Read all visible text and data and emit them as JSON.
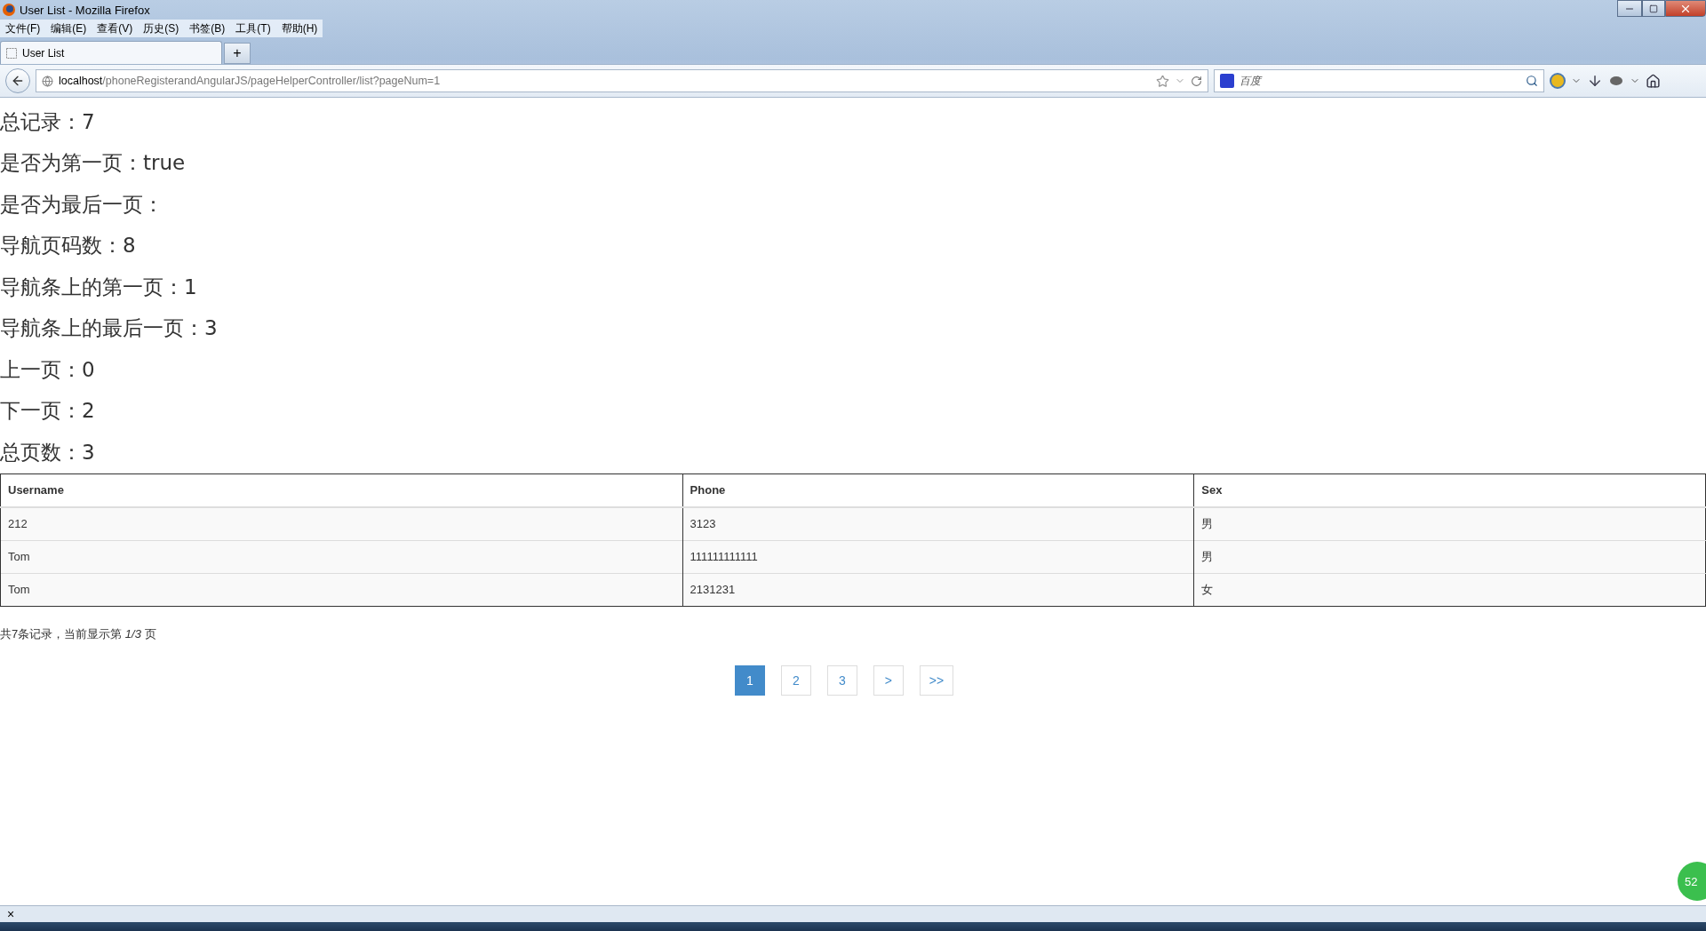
{
  "window": {
    "title": "User List - Mozilla Firefox"
  },
  "menu": [
    "文件(F)",
    "编辑(E)",
    "查看(V)",
    "历史(S)",
    "书签(B)",
    "工具(T)",
    "帮助(H)"
  ],
  "tabs": [
    {
      "label": "User List",
      "selected": true
    }
  ],
  "new_tab": "+",
  "address": {
    "host": "localhost",
    "path": "/phoneRegisterandAngularJS/pageHelperController/list?pageNum=1"
  },
  "search": {
    "placeholder": "百度"
  },
  "info_lines": [
    {
      "label": "总记录：",
      "value": "7"
    },
    {
      "label": "是否为第一页：",
      "value": "true"
    },
    {
      "label": "是否为最后一页："
    },
    {
      "label": "导航页码数：",
      "value": "8"
    },
    {
      "label": "导航条上的第一页：",
      "value": "1"
    },
    {
      "label": "导航条上的最后一页：",
      "value": "3"
    },
    {
      "label": "上一页：",
      "value": "0"
    },
    {
      "label": "下一页：",
      "value": "2"
    },
    {
      "label": "总页数：",
      "value": "3"
    }
  ],
  "table": {
    "columns": [
      "Username",
      "Phone",
      "Sex"
    ],
    "rows": [
      [
        "212",
        "3123",
        "男"
      ],
      [
        "Tom",
        "111111111111",
        "男"
      ],
      [
        "Tom",
        "2131231",
        "女"
      ]
    ]
  },
  "summary": "共7条记录，当前显示第 *1/3* 页",
  "pagination": [
    {
      "label": "1",
      "selected": true
    },
    {
      "label": "2",
      "selected": false
    },
    {
      "label": "3",
      "selected": false
    },
    {
      "label": ">",
      "selected": false
    },
    {
      "label": ">>",
      "selected": false
    }
  ],
  "floating_badge": "52",
  "status_bar": {
    "close": "×"
  }
}
